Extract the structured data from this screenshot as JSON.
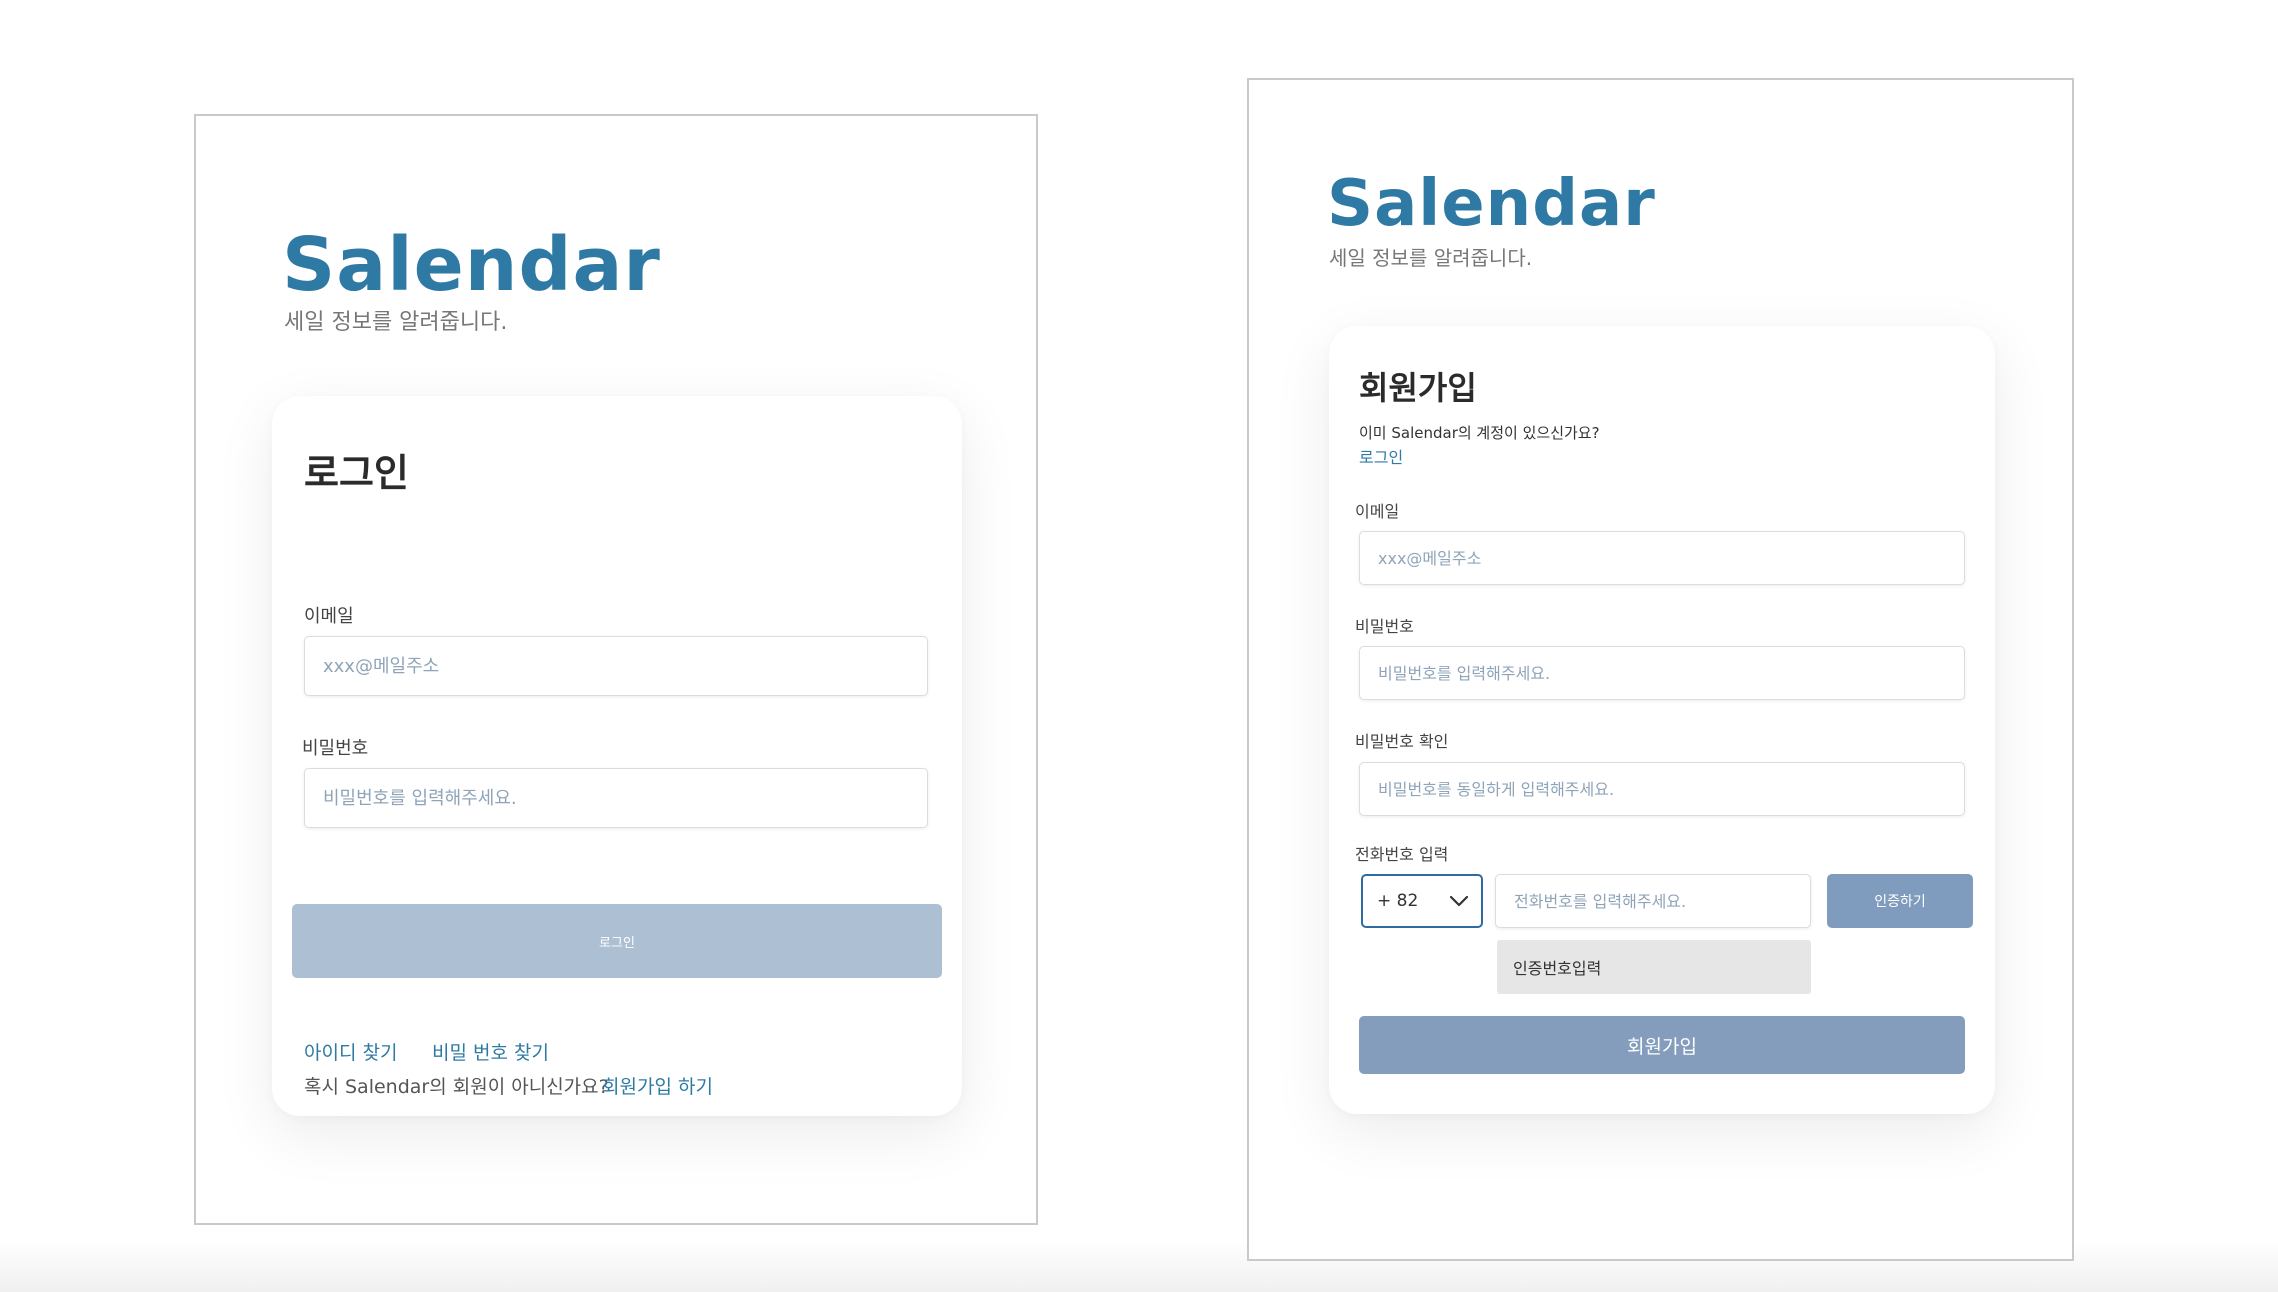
{
  "login": {
    "brand": "Salendar",
    "tagline": "세일 정보를 알려줍니다.",
    "title": "로그인",
    "email_label": "이메일",
    "email_placeholder": "xxx@메일주소",
    "password_label": "비밀번호",
    "password_placeholder": "비밀번호를 입력해주세요.",
    "submit_label": "로그인",
    "find_id_link": "아이디 찾기",
    "find_password_link": "비밀 번호 찾기",
    "not_member_text": "혹시 Salendar의 회원이 아니신가요?",
    "signup_link": "회원가입 하기"
  },
  "signup": {
    "brand": "Salendar",
    "tagline": "세일 정보를 알려줍니다.",
    "title": "회원가입",
    "already_member_text": "이미 Salendar의 계정이 있으신가요?",
    "login_link": "로그인",
    "email_label": "이메일",
    "email_placeholder": "xxx@메일주소",
    "password_label": "비밀번호",
    "password_placeholder": "비밀번호를 입력해주세요.",
    "password_confirm_label": "비밀번호 확인",
    "password_confirm_placeholder": "비밀번호를 동일하게 입력해주세요.",
    "phone_label": "전화번호 입력",
    "country_code": "+ 82",
    "phone_placeholder": "전화번호를 입력해주세요.",
    "verify_button": "인증하기",
    "verification_code_placeholder": "인증번호입력",
    "submit_label": "회원가입"
  },
  "colors": {
    "brand": "#2f7aa5",
    "login_button": "#adbfd2",
    "signup_button": "#849dbd",
    "verify_button": "#7f9bbd"
  },
  "icons": {
    "country_dropdown": "chevron-down-icon"
  }
}
